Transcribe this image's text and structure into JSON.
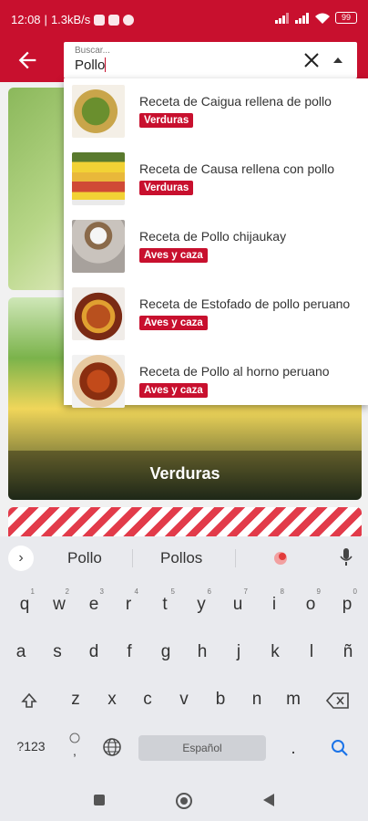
{
  "status": {
    "time": "12:08",
    "speed": "1.3kB/s",
    "battery": "99"
  },
  "appbar": {
    "search_placeholder": "Buscar...",
    "search_value": "Pollo"
  },
  "background_cards": [
    {
      "label": ""
    },
    {
      "label": "Verduras"
    },
    {
      "label": ""
    }
  ],
  "results": [
    {
      "title": "Receta de Caigua rellena de pollo",
      "tag": "Verduras"
    },
    {
      "title": "Receta de Causa rellena con pollo",
      "tag": "Verduras"
    },
    {
      "title": "Receta de Pollo chijaukay",
      "tag": "Aves y caza"
    },
    {
      "title": "Receta de Estofado de pollo peruano",
      "tag": "Aves y caza"
    },
    {
      "title": "Receta de Pollo al horno peruano",
      "tag": "Aves y caza"
    }
  ],
  "keyboard": {
    "suggestions": [
      "Pollo",
      "Pollos"
    ],
    "row1": [
      "q",
      "w",
      "e",
      "r",
      "t",
      "y",
      "u",
      "i",
      "o",
      "p"
    ],
    "row1_nums": [
      "1",
      "2",
      "3",
      "4",
      "5",
      "6",
      "7",
      "8",
      "9",
      "0"
    ],
    "row2": [
      "a",
      "s",
      "d",
      "f",
      "g",
      "h",
      "j",
      "k",
      "l",
      "ñ"
    ],
    "row3": [
      "z",
      "x",
      "c",
      "v",
      "b",
      "n",
      "m"
    ],
    "sym_key": "?123",
    "comma": ",",
    "space_label": "Español",
    "period": "."
  },
  "colors": {
    "brand_red": "#c8102e",
    "keyboard_bg": "#e9eaee",
    "accent_blue": "#1a73e8"
  },
  "icons": [
    "back-arrow-icon",
    "clear-icon",
    "dropdown-icon",
    "chevron-right-icon",
    "sticker-icon",
    "microphone-icon",
    "shift-icon",
    "backspace-icon",
    "globe-icon",
    "search-icon",
    "nav-square-icon",
    "nav-circle-icon",
    "nav-back-icon"
  ]
}
